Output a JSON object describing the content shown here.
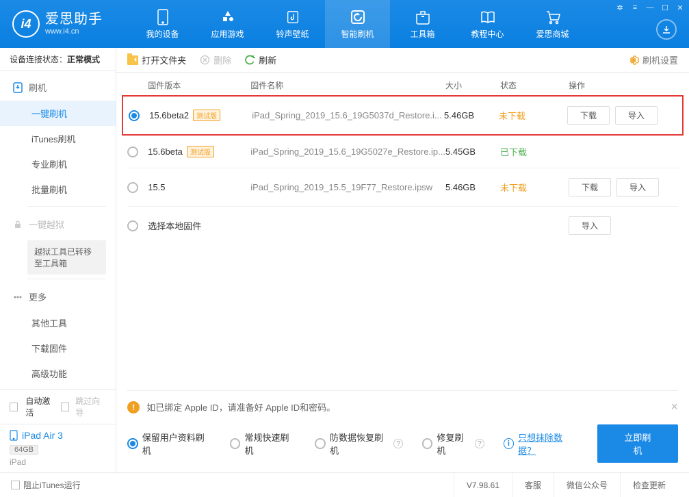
{
  "app": {
    "title": "爱思助手",
    "subtitle": "www.i4.cn"
  },
  "nav": [
    {
      "label": "我的设备"
    },
    {
      "label": "应用游戏"
    },
    {
      "label": "铃声壁纸"
    },
    {
      "label": "智能刷机"
    },
    {
      "label": "工具箱"
    },
    {
      "label": "教程中心"
    },
    {
      "label": "爱思商城"
    }
  ],
  "sidebar": {
    "status_label": "设备连接状态：",
    "status_value": "正常模式",
    "flash": {
      "head": "刷机",
      "items": [
        "一键刷机",
        "iTunes刷机",
        "专业刷机",
        "批量刷机"
      ]
    },
    "jailbreak": {
      "head": "一键越狱",
      "note": "越狱工具已转移至工具箱"
    },
    "more": {
      "head": "更多",
      "items": [
        "其他工具",
        "下载固件",
        "高级功能"
      ]
    },
    "auto_activate": "自动激活",
    "skip_guide": "跳过向导",
    "device": {
      "name": "iPad Air 3",
      "capacity": "64GB",
      "model": "iPad"
    }
  },
  "toolbar": {
    "open": "打开文件夹",
    "delete": "删除",
    "refresh": "刷新",
    "settings": "刷机设置"
  },
  "columns": {
    "version": "固件版本",
    "name": "固件名称",
    "size": "大小",
    "status": "状态",
    "action": "操作"
  },
  "firmware": [
    {
      "version": "15.6beta2",
      "beta": "测试版",
      "name": "iPad_Spring_2019_15.6_19G5037d_Restore.i...",
      "size": "5.46GB",
      "status": "未下载",
      "status_class": "st-not",
      "selected": true,
      "highlight": true,
      "actions": [
        "下载",
        "导入"
      ]
    },
    {
      "version": "15.6beta",
      "beta": "测试版",
      "name": "iPad_Spring_2019_15.6_19G5027e_Restore.ip...",
      "size": "5.45GB",
      "status": "已下载",
      "status_class": "st-done",
      "selected": false,
      "highlight": false,
      "actions": []
    },
    {
      "version": "15.5",
      "beta": "",
      "name": "iPad_Spring_2019_15.5_19F77_Restore.ipsw",
      "size": "5.46GB",
      "status": "未下载",
      "status_class": "st-not",
      "selected": false,
      "highlight": false,
      "actions": [
        "下载",
        "导入"
      ]
    },
    {
      "version": "选择本地固件",
      "beta": "",
      "name": "",
      "size": "",
      "status": "",
      "status_class": "",
      "selected": false,
      "highlight": false,
      "actions": [
        "导入"
      ]
    }
  ],
  "notice": "如已绑定 Apple ID，请准备好 Apple ID和密码。",
  "options": {
    "keep_data": "保留用户资料刷机",
    "quick": "常规快速刷机",
    "anti_recovery": "防数据恢复刷机",
    "repair": "修复刷机",
    "erase_link": "只想抹除数据？",
    "flash_btn": "立即刷机"
  },
  "footer": {
    "block_itunes": "阻止iTunes运行",
    "version": "V7.98.61",
    "service": "客服",
    "wechat": "微信公众号",
    "check_update": "检查更新"
  }
}
